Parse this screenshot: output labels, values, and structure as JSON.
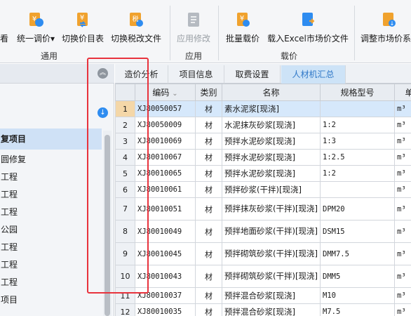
{
  "ribbon": {
    "buttons": {
      "view": "看",
      "unify_price": "统一调价",
      "switch_price_table": "切换价目表",
      "switch_tax_file": "切换税改文件",
      "apply_modify": "应用修改",
      "batch_load_price": "批量载价",
      "load_excel_market": "载入Excel市场价文件",
      "adjust_market": "调整市场价系"
    },
    "groups": {
      "general": "通用",
      "apply": "应用",
      "load_price": "载价"
    },
    "icon_glyphs": {
      "unify": "¥",
      "switch_table": "¥",
      "switch_tax": "税",
      "batch": "¥",
      "adjust": "↓"
    },
    "dropdown_glyph": "▾"
  },
  "left_panel": {
    "collapse_glyph": "︽",
    "download_glyph": "↓",
    "selected_item": "复项目",
    "items": [
      "圆修复",
      "工程",
      "工程",
      "工程",
      "公园",
      "工程",
      "工程",
      "工程",
      "项目",
      "…"
    ]
  },
  "tabs": [
    {
      "label": "造价分析",
      "active": false
    },
    {
      "label": "项目信息",
      "active": false
    },
    {
      "label": "取费设置",
      "active": false
    },
    {
      "label": "人材机汇总",
      "active": true
    }
  ],
  "table": {
    "columns": {
      "code": "编码",
      "category": "类别",
      "name": "名称",
      "spec": "规格型号",
      "unit": "单"
    },
    "sort_glyph": "⌄",
    "rows": [
      {
        "num": "1",
        "code": "XJ80050057",
        "category": "材",
        "name": "素水泥浆[现浇]",
        "spec": "",
        "unit": "m³"
      },
      {
        "num": "2",
        "code": "XJ80050009",
        "category": "材",
        "name": "水泥抹灰砂浆[现浇]",
        "spec": "1:2",
        "unit": "m³"
      },
      {
        "num": "3",
        "code": "XJ80010069",
        "category": "材",
        "name": "预拌水泥砂浆[现浇]",
        "spec": "1:3",
        "unit": "m³"
      },
      {
        "num": "4",
        "code": "XJ80010067",
        "category": "材",
        "name": "预拌水泥砂浆[现浇]",
        "spec": "1:2.5",
        "unit": "m³"
      },
      {
        "num": "5",
        "code": "XJ80010065",
        "category": "材",
        "name": "预拌水泥砂浆[现浇]",
        "spec": "1:2",
        "unit": "m³"
      },
      {
        "num": "6",
        "code": "XJ80010061",
        "category": "材",
        "name": "预拌砂浆(干拌)[现浇]",
        "spec": "",
        "unit": "m³"
      },
      {
        "num": "7",
        "code": "XJ80010051",
        "category": "材",
        "name": "预拌抹灰砂浆(干拌)[现浇]",
        "spec": "DPM20",
        "unit": "m³"
      },
      {
        "num": "8",
        "code": "XJ80010049",
        "category": "材",
        "name": "预拌地面砂浆(干拌)[现浇]",
        "spec": "DSM15",
        "unit": "m³"
      },
      {
        "num": "9",
        "code": "XJ80010045",
        "category": "材",
        "name": "预拌砌筑砂浆(干拌)[现浇]",
        "spec": "DMM7.5",
        "unit": "m³"
      },
      {
        "num": "10",
        "code": "XJ80010043",
        "category": "材",
        "name": "预拌砌筑砂浆(干拌)[现浇]",
        "spec": "DMM5",
        "unit": "m³"
      },
      {
        "num": "11",
        "code": "XJ80010037",
        "category": "材",
        "name": "预拌混合砂浆[现浇]",
        "spec": "M10",
        "unit": "m³"
      },
      {
        "num": "12",
        "code": "XJ80010035",
        "category": "材",
        "name": "预拌混合砂浆[现浇]",
        "spec": "M7.5",
        "unit": "m³"
      }
    ]
  },
  "colors": {
    "accent": "#2e8cf0",
    "active_tab_text": "#2f78c8",
    "highlight_box": "#e8333d",
    "selected_row": "#d6e8fb"
  }
}
